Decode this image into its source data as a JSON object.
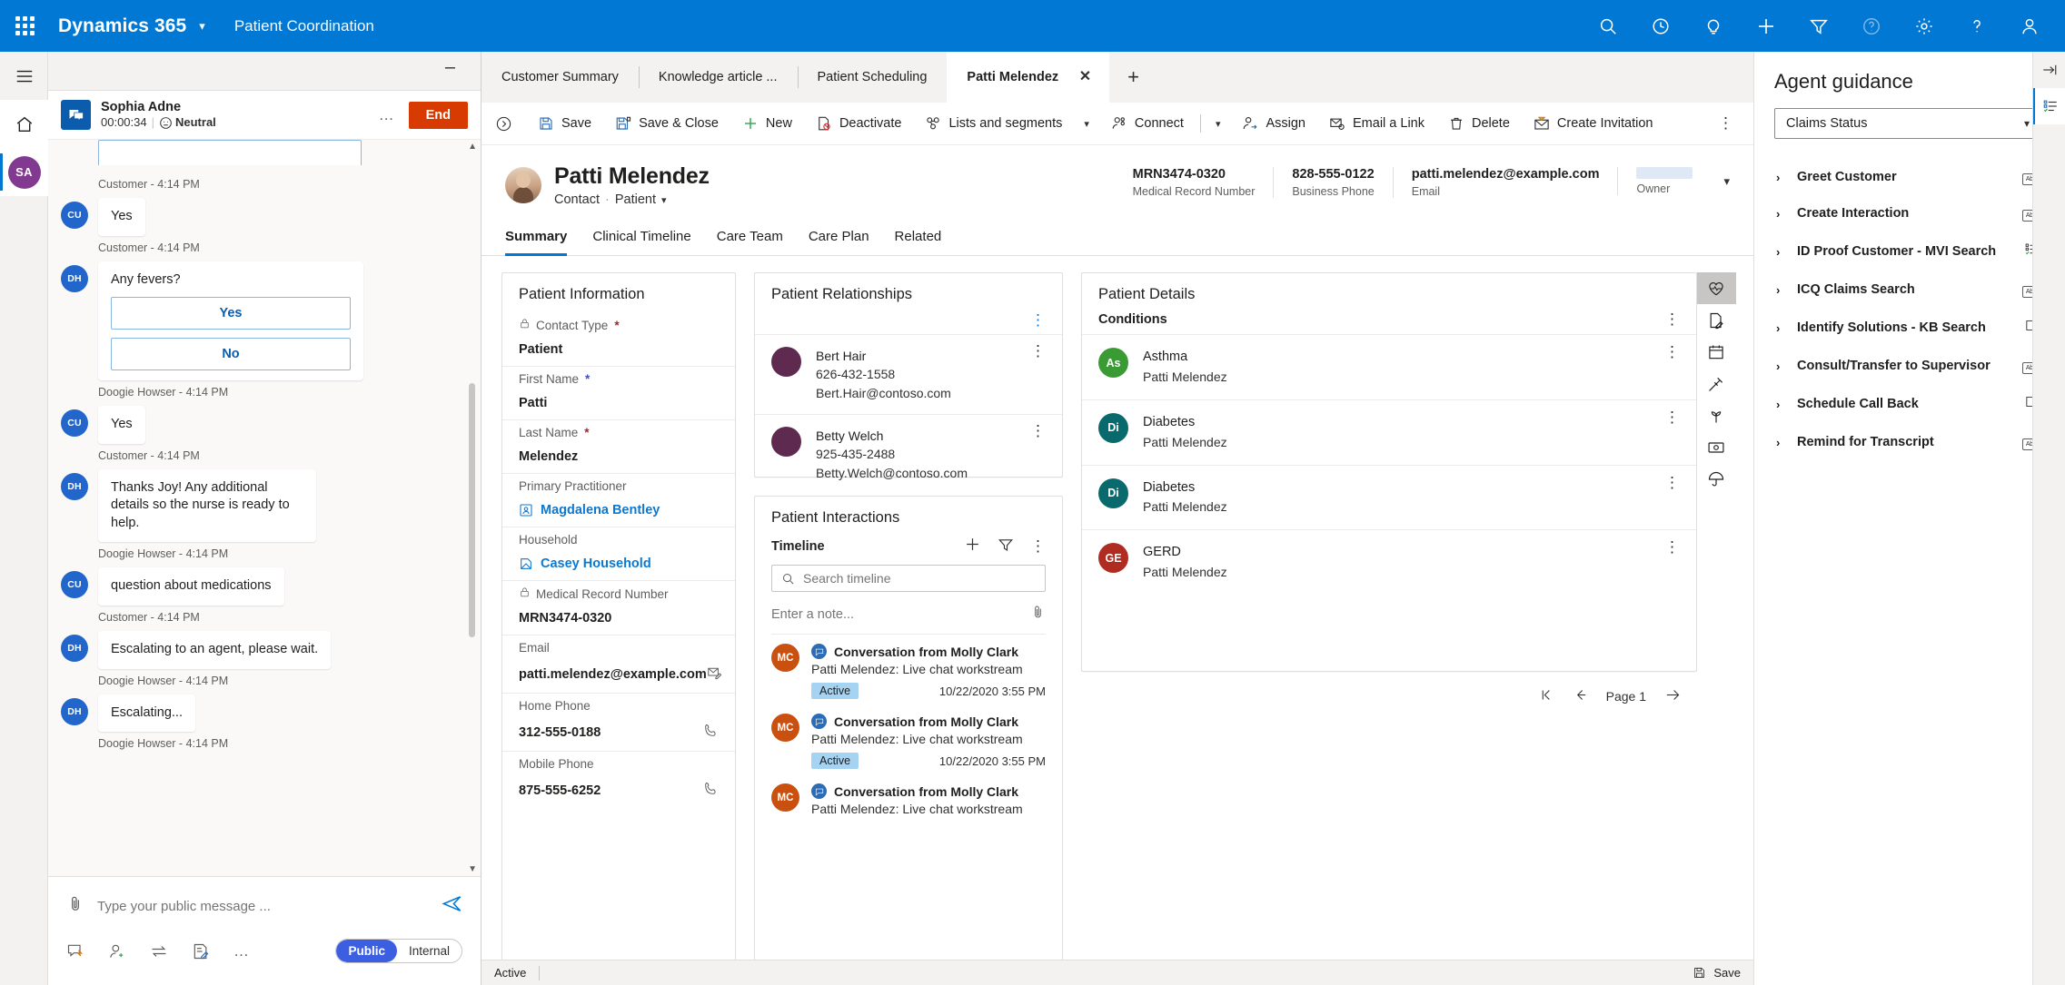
{
  "topbar": {
    "brand": "Dynamics 365",
    "app_name": "Patient Coordination",
    "icons": [
      "search-icon",
      "assistant-icon",
      "lightbulb-icon",
      "add-icon",
      "filter-icon",
      "help-circle-icon",
      "settings-gear-icon",
      "question-mark-icon",
      "user-account-icon"
    ]
  },
  "chat": {
    "customer_name": "Sophia Adne",
    "timer": "00:00:34",
    "sentiment": "Neutral",
    "end_label": "End",
    "messages": [
      {
        "initials": "CU",
        "text": "Yes",
        "meta": "Customer - 4:14 PM",
        "type": "text"
      },
      {
        "initials": "DH",
        "text": "Any fevers?",
        "meta": "Doogie Howser - 4:14 PM",
        "type": "choices",
        "choices": [
          "Yes",
          "No"
        ]
      },
      {
        "initials": "CU",
        "text": "Yes",
        "meta": "Customer - 4:14 PM",
        "type": "text"
      },
      {
        "initials": "DH",
        "text": "Thanks Joy! Any additional details so the nurse is ready to help.",
        "meta": "Doogie Howser - 4:14 PM",
        "type": "text"
      },
      {
        "initials": "CU",
        "text": "question about medications",
        "meta": "Customer - 4:14 PM",
        "type": "text"
      },
      {
        "initials": "DH",
        "text": "Escalating to an agent, please wait.",
        "meta": "Doogie Howser - 4:14 PM",
        "type": "text"
      },
      {
        "initials": "DH",
        "text": "Escalating...",
        "meta": "Doogie Howser - 4:14 PM",
        "type": "text"
      }
    ],
    "composer_placeholder": "Type your public message ...",
    "tools": [
      "quick-reply-icon",
      "add-agent-icon",
      "transfer-icon",
      "note-icon",
      "more-options-icon"
    ],
    "toggle": {
      "public": "Public",
      "internal": "Internal",
      "selected": "Public"
    }
  },
  "rail": {
    "items": [
      "hamburger-menu-icon",
      "home-icon",
      "session-avatar"
    ],
    "session_initials": "SA"
  },
  "tabs": [
    {
      "label": "Customer Summary",
      "active": false
    },
    {
      "label": "Knowledge article ...",
      "active": false
    },
    {
      "label": "Patient Scheduling",
      "active": false
    },
    {
      "label": "Patti Melendez",
      "active": true
    }
  ],
  "commandbar": {
    "items": [
      {
        "label": "Save",
        "icon": "save-icon"
      },
      {
        "label": "Save & Close",
        "icon": "save-close-icon"
      },
      {
        "label": "New",
        "icon": "plus-icon"
      },
      {
        "label": "Deactivate",
        "icon": "deactivate-icon"
      },
      {
        "label": "Lists and segments",
        "icon": "lists-segments-icon",
        "caret": true
      },
      {
        "label": "Connect",
        "icon": "connect-icon",
        "caret": true,
        "divider": true
      },
      {
        "label": "Assign",
        "icon": "assign-icon"
      },
      {
        "label": "Email a Link",
        "icon": "email-link-icon"
      },
      {
        "label": "Delete",
        "icon": "trash-icon"
      },
      {
        "label": "Create Invitation",
        "icon": "create-invitation-icon"
      }
    ],
    "more": "overflow-icon"
  },
  "record": {
    "title": "Patti Melendez",
    "entity": "Contact",
    "type": "Patient",
    "header_fields": [
      {
        "value": "MRN3474-0320",
        "label": "Medical Record Number"
      },
      {
        "value": "828-555-0122",
        "label": "Business Phone"
      },
      {
        "value": "patti.melendez@example.com",
        "label": "Email"
      },
      {
        "value": "",
        "label": "Owner"
      }
    ],
    "form_tabs": [
      {
        "label": "Summary",
        "active": true
      },
      {
        "label": "Clinical Timeline",
        "active": false
      },
      {
        "label": "Care Team",
        "active": false
      },
      {
        "label": "Care Plan",
        "active": false
      },
      {
        "label": "Related",
        "active": false
      }
    ]
  },
  "patient_information": {
    "title": "Patient Information",
    "fields": [
      {
        "label": "Contact Type",
        "value": "Patient",
        "required": true,
        "locked": true,
        "req_color": "red"
      },
      {
        "label": "First Name",
        "value": "Patti",
        "required": true,
        "req_color": "blue"
      },
      {
        "label": "Last Name",
        "value": "Melendez",
        "required": true,
        "req_color": "red"
      },
      {
        "label": "Primary Practitioner",
        "value": "Magdalena Bentley",
        "link": true,
        "icon": "practitioner-icon"
      },
      {
        "label": "Household",
        "value": "Casey Household",
        "link": true,
        "icon": "household-icon"
      },
      {
        "label": "Medical Record Number",
        "value": "MRN3474-0320",
        "locked": true
      },
      {
        "label": "Email",
        "value": "patti.melendez@example.com",
        "action": "send-email-icon"
      },
      {
        "label": "Home Phone",
        "value": "312-555-0188",
        "action": "call-icon"
      },
      {
        "label": "Mobile Phone",
        "value": "875-555-6252",
        "action": "call-icon"
      }
    ]
  },
  "patient_relationships": {
    "title": "Patient Relationships",
    "rows": [
      {
        "name": "Bert Hair",
        "phone": "626-432-1558",
        "email": "Bert.Hair@contoso.com"
      },
      {
        "name": "Betty Welch",
        "phone": "925-435-2488",
        "email": "Betty.Welch@contoso.com"
      }
    ]
  },
  "patient_interactions": {
    "title": "Patient Interactions",
    "timeline_label": "Timeline",
    "search_placeholder": "Search timeline",
    "note_placeholder": "Enter a note...",
    "items": [
      {
        "initials": "MC",
        "title": "Conversation from Molly Clark",
        "subtitle": "Patti Melendez: Live chat workstream",
        "status": "Active",
        "date": "10/22/2020 3:55 PM"
      },
      {
        "initials": "MC",
        "title": "Conversation from Molly Clark",
        "subtitle": "Patti Melendez: Live chat workstream",
        "status": "Active",
        "date": "10/22/2020 3:55 PM"
      },
      {
        "initials": "MC",
        "title": "Conversation from Molly Clark",
        "subtitle": "Patti Melendez: Live chat workstream",
        "status": "",
        "date": ""
      }
    ]
  },
  "patient_details": {
    "title": "Patient Details",
    "section": "Conditions",
    "conditions": [
      {
        "initials": "As",
        "name": "Asthma",
        "patient": "Patti Melendez",
        "color": "#3a9b35"
      },
      {
        "initials": "Di",
        "name": "Diabetes",
        "patient": "Patti Melendez",
        "color": "#096a6e"
      },
      {
        "initials": "Di",
        "name": "Diabetes",
        "patient": "Patti Melendez",
        "color": "#096a6e"
      },
      {
        "initials": "GE",
        "name": "GERD",
        "patient": "Patti Melendez",
        "color": "#b02b20"
      }
    ],
    "page_label": "Page 1",
    "vrail_icons": [
      "heart-pulse-icon",
      "document-edit-icon",
      "calendar-icon",
      "syringe-icon",
      "allergy-icon",
      "payment-icon",
      "insurance-umbrella-icon"
    ]
  },
  "statusbar": {
    "status": "Active",
    "save_label": "Save",
    "save_icon": "save-icon"
  },
  "guidance": {
    "title": "Agent guidance",
    "selected_flow": "Claims Status",
    "items": [
      {
        "label": "Greet Customer",
        "icon": "abx-icon"
      },
      {
        "label": "Create Interaction",
        "icon": "abx-icon"
      },
      {
        "label": "ID Proof Customer - MVI Search",
        "icon": "checklist-icon"
      },
      {
        "label": "ICQ Claims Search",
        "icon": "abx-icon"
      },
      {
        "label": "Identify Solutions - KB Search",
        "icon": "script-icon"
      },
      {
        "label": "Consult/Transfer to Supervisor",
        "icon": "abx-icon"
      },
      {
        "label": "Schedule Call Back",
        "icon": "script-icon"
      },
      {
        "label": "Remind for Transcript",
        "icon": "abx-icon"
      }
    ],
    "rail": [
      "expand-panel-icon",
      "agent-script-icon"
    ]
  },
  "colors": {
    "brand": "#0078d4",
    "end": "#d83b01",
    "link": "#0b78d1",
    "active_badge": "#a6d3f2"
  }
}
